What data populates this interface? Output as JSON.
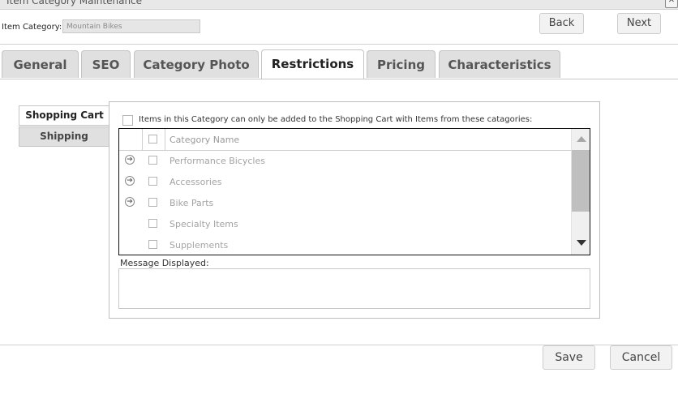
{
  "window": {
    "title": "Item Category Maintenance",
    "close_glyph": "✕"
  },
  "header": {
    "category_label": "Item Category:",
    "category_value": "Mountain Bikes",
    "back_label": "Back",
    "next_label": "Next"
  },
  "tabs": [
    {
      "label": "General"
    },
    {
      "label": "SEO"
    },
    {
      "label": "Category Photo"
    },
    {
      "label": "Restrictions",
      "active": true
    },
    {
      "label": "Pricing"
    },
    {
      "label": "Characteristics"
    }
  ],
  "subtabs": [
    {
      "label": "Shopping Cart",
      "active": true
    },
    {
      "label": "Shipping"
    }
  ],
  "restrictions": {
    "checkbox_label": "Items in this Category can only be added to the Shopping Cart with Items from these catagories:",
    "column_header": "Category Name",
    "rows": [
      {
        "name": "Performance Bicycles",
        "expandable": true
      },
      {
        "name": "Accessories",
        "expandable": true
      },
      {
        "name": "Bike Parts",
        "expandable": true
      },
      {
        "name": "Specialty Items",
        "expandable": false
      },
      {
        "name": "Supplements",
        "expandable": false
      }
    ],
    "message_label": "Message Displayed:",
    "message_value": ""
  },
  "footer": {
    "save_label": "Save",
    "cancel_label": "Cancel"
  },
  "icons": {
    "expand": "arrow-right-circle-icon"
  }
}
